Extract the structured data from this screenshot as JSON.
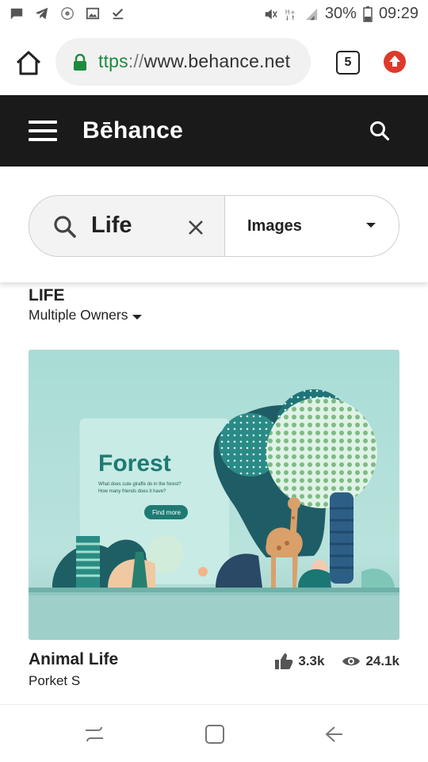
{
  "status_bar": {
    "battery": "30%",
    "time": "09:29"
  },
  "browser": {
    "url_scheme": "ttps",
    "url_sep": "://",
    "url_host": "www.behance.net",
    "tab_count": "5"
  },
  "header": {
    "logo": "Bēhance"
  },
  "search": {
    "query": "Life",
    "type": "Images"
  },
  "collection": {
    "title": "LIFE",
    "owners_label": "Multiple Owners"
  },
  "project": {
    "artwork": {
      "title": "Forest",
      "subtitle_line1": "What does cute giraffe do in the forest?",
      "subtitle_line2": "How many friends does it have?",
      "cta": "Find more"
    },
    "title": "Animal Life",
    "owner": "Porket S",
    "likes": "3.3k",
    "views": "24.1k"
  },
  "colors": {
    "header_bg": "#1a1a1a",
    "lock_green": "#1e8a3e",
    "update_red": "#e0382b",
    "artwork_teal": "#1f7a73"
  }
}
